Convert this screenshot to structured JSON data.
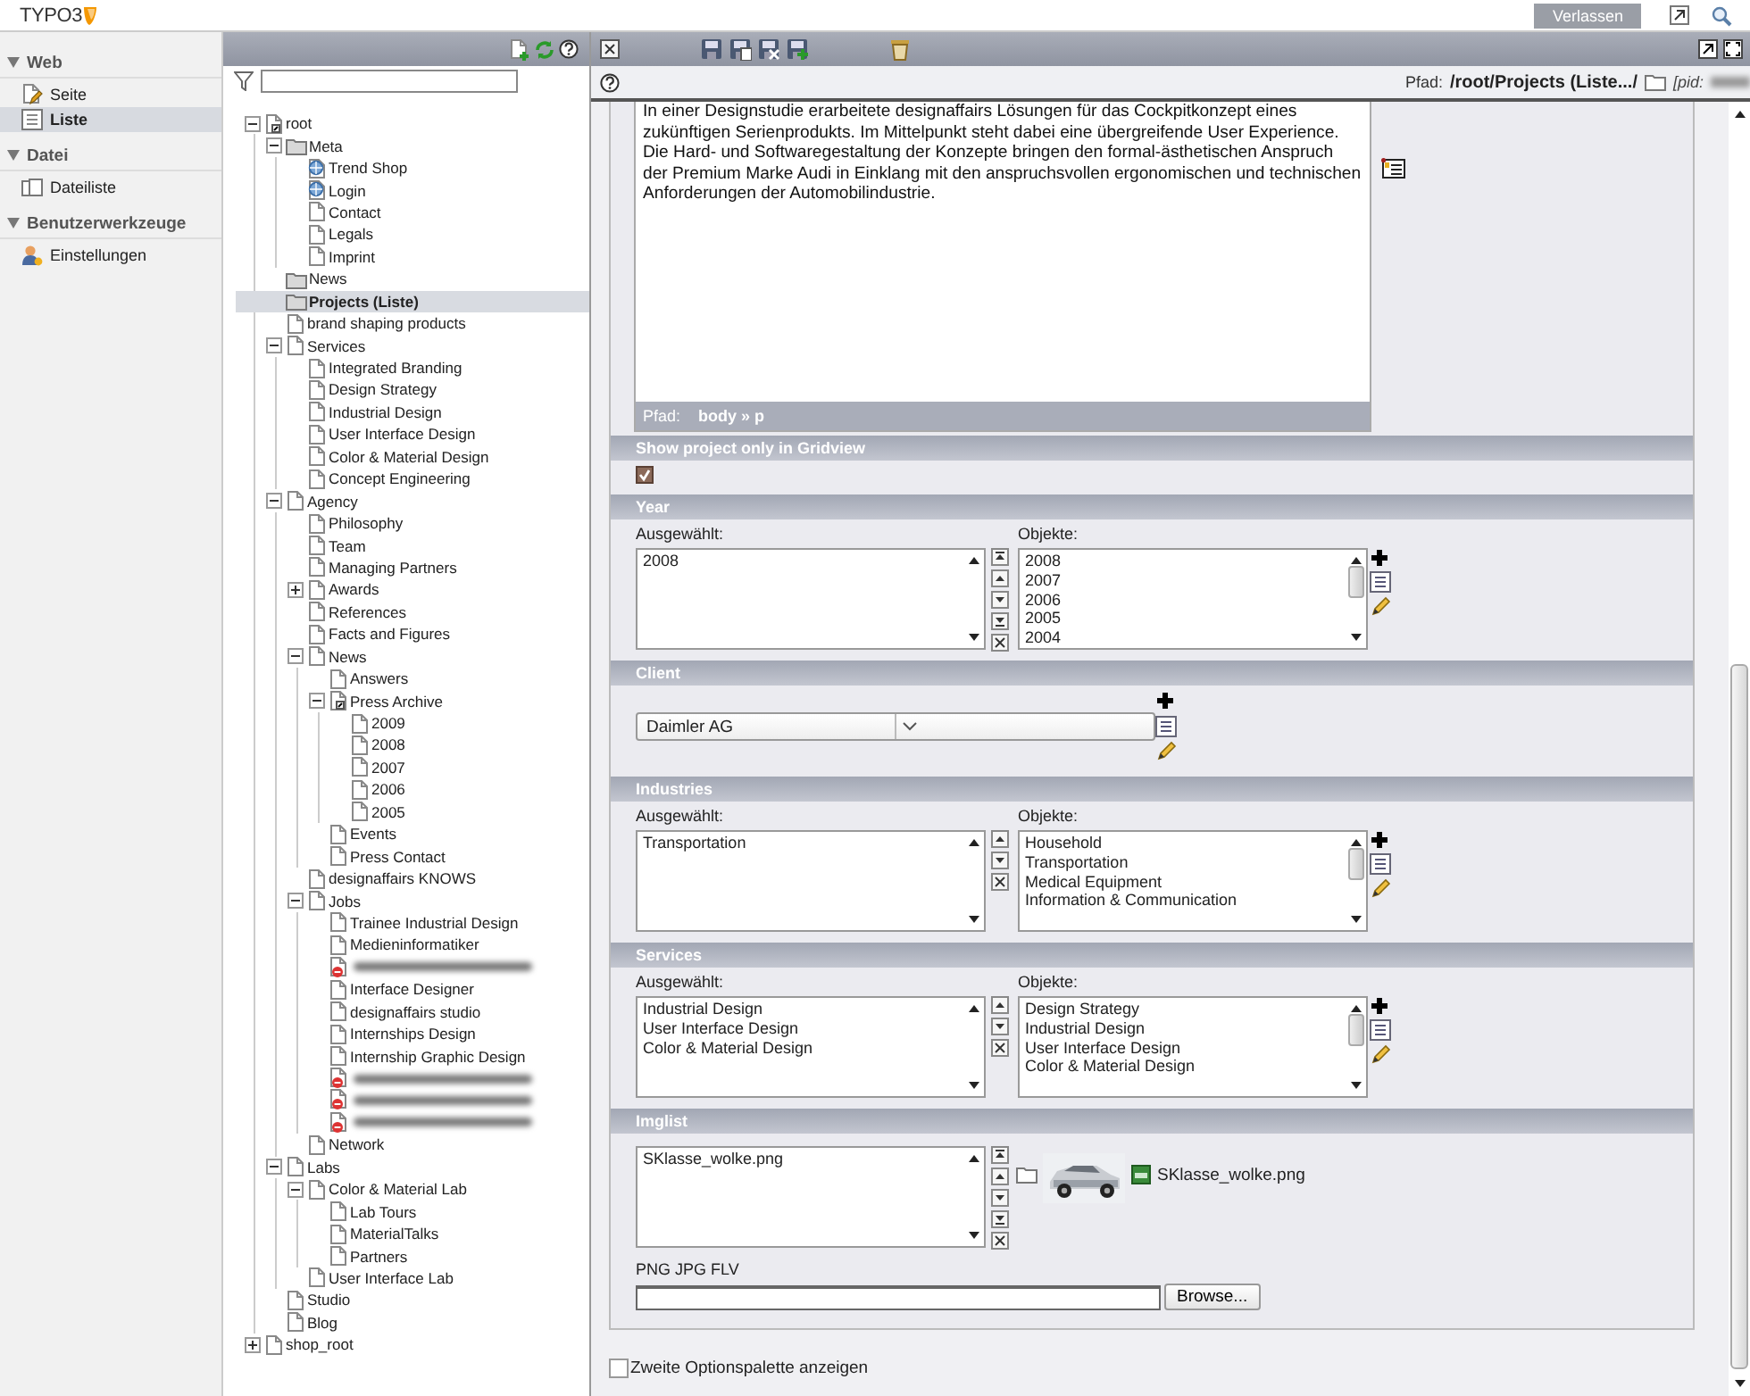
{
  "top_bar": {
    "logo": "TYPO3",
    "logout_button": "Verlassen"
  },
  "modules": [
    {
      "title": "Web",
      "expanded": true,
      "items": [
        {
          "label": "Seite",
          "kind": "page",
          "selected": false
        },
        {
          "label": "Liste",
          "kind": "list",
          "selected": true
        }
      ]
    },
    {
      "title": "Datei",
      "expanded": true,
      "items": [
        {
          "label": "Dateiliste",
          "kind": "files",
          "selected": false
        }
      ]
    },
    {
      "title": "Benutzerwerkzeuge",
      "expanded": true,
      "items": [
        {
          "label": "Einstellungen",
          "kind": "user",
          "selected": false
        }
      ]
    }
  ],
  "page_tree": {
    "nodes": [
      {
        "label": "root",
        "kind": "mount",
        "expanded": true,
        "selected": false,
        "children": [
          {
            "label": "Meta",
            "kind": "folder",
            "expanded": true,
            "selected": false,
            "children": [
              {
                "label": "Trend Shop",
                "kind": "link",
                "selected": false
              },
              {
                "label": "Login",
                "kind": "link",
                "selected": false
              },
              {
                "label": "Contact",
                "kind": "page",
                "selected": false
              },
              {
                "label": "Legals",
                "kind": "page",
                "selected": false
              },
              {
                "label": "Imprint",
                "kind": "page",
                "selected": false
              }
            ]
          },
          {
            "label": "News",
            "kind": "folder",
            "selected": false
          },
          {
            "label": "Projects (Liste)",
            "kind": "folder",
            "selected": true
          },
          {
            "label": "brand shaping products",
            "kind": "page",
            "selected": false
          },
          {
            "label": "Services",
            "kind": "page",
            "expanded": true,
            "selected": false,
            "children": [
              {
                "label": "Integrated Branding",
                "kind": "page",
                "selected": false
              },
              {
                "label": "Design Strategy",
                "kind": "page",
                "selected": false
              },
              {
                "label": "Industrial Design",
                "kind": "page",
                "selected": false
              },
              {
                "label": "User Interface Design",
                "kind": "page",
                "selected": false
              },
              {
                "label": "Color & Material Design",
                "kind": "page",
                "selected": false
              },
              {
                "label": "Concept Engineering",
                "kind": "page",
                "selected": false
              }
            ]
          },
          {
            "label": "Agency",
            "kind": "page",
            "expanded": true,
            "selected": false,
            "children": [
              {
                "label": "Philosophy",
                "kind": "page",
                "selected": false
              },
              {
                "label": "Team",
                "kind": "page",
                "selected": false
              },
              {
                "label": "Managing Partners",
                "kind": "page",
                "selected": false
              },
              {
                "label": "Awards",
                "kind": "page",
                "expanded": false,
                "selected": false
              },
              {
                "label": "References",
                "kind": "page",
                "selected": false
              },
              {
                "label": "Facts and Figures",
                "kind": "page",
                "selected": false
              },
              {
                "label": "News",
                "kind": "page",
                "expanded": true,
                "selected": false,
                "children": [
                  {
                    "label": "Answers",
                    "kind": "page",
                    "selected": false
                  },
                  {
                    "label": "Press Archive",
                    "kind": "shortcut",
                    "expanded": true,
                    "selected": false,
                    "children": [
                      {
                        "label": "2009",
                        "kind": "page",
                        "selected": false
                      },
                      {
                        "label": "2008",
                        "kind": "page",
                        "selected": false
                      },
                      {
                        "label": "2007",
                        "kind": "page",
                        "selected": false
                      },
                      {
                        "label": "2006",
                        "kind": "page",
                        "selected": false
                      },
                      {
                        "label": "2005",
                        "kind": "page",
                        "selected": false
                      }
                    ]
                  },
                  {
                    "label": "Events",
                    "kind": "page",
                    "selected": false
                  },
                  {
                    "label": "Press Contact",
                    "kind": "page",
                    "selected": false
                  }
                ]
              },
              {
                "label": "designaffairs KNOWS",
                "kind": "page",
                "selected": false
              },
              {
                "label": "Jobs",
                "kind": "page",
                "expanded": true,
                "selected": false,
                "children": [
                  {
                    "label": "Trainee Industrial Design",
                    "kind": "page",
                    "selected": false
                  },
                  {
                    "label": "Medieninformatiker",
                    "kind": "page",
                    "selected": false
                  },
                  {
                    "kind": "blurred",
                    "selected": false
                  },
                  {
                    "label": "Interface Designer",
                    "kind": "page",
                    "selected": false
                  },
                  {
                    "label": "designaffairs studio",
                    "kind": "page",
                    "selected": false
                  },
                  {
                    "label": "Internships Design",
                    "kind": "page",
                    "selected": false
                  },
                  {
                    "label": "Internship Graphic Design",
                    "kind": "page",
                    "selected": false
                  },
                  {
                    "kind": "blurred",
                    "selected": false
                  },
                  {
                    "kind": "blurred",
                    "selected": false
                  },
                  {
                    "kind": "blurred",
                    "selected": false
                  }
                ]
              },
              {
                "label": "Network",
                "kind": "page",
                "selected": false
              }
            ]
          },
          {
            "label": "Labs",
            "kind": "page",
            "expanded": true,
            "selected": false,
            "children": [
              {
                "label": "Color & Material Lab",
                "kind": "page",
                "expanded": true,
                "selected": false,
                "children": [
                  {
                    "label": "Lab Tours",
                    "kind": "page",
                    "selected": false
                  },
                  {
                    "label": "MaterialTalks",
                    "kind": "page",
                    "selected": false
                  },
                  {
                    "label": "Partners",
                    "kind": "page",
                    "selected": false
                  }
                ]
              },
              {
                "label": "User Interface Lab",
                "kind": "page",
                "selected": false
              }
            ]
          },
          {
            "label": "Studio",
            "kind": "page",
            "selected": false
          },
          {
            "label": "Blog",
            "kind": "page",
            "selected": false
          }
        ]
      },
      {
        "label": "shop_root",
        "kind": "page",
        "expanded": false,
        "selected": false
      }
    ]
  },
  "editor": {
    "path_label": "Pfad:",
    "path": "/root/Projects (Liste.../",
    "pid_label": "[pid:",
    "rte": {
      "text": "In einer Designstudie erarbeitete designaffairs Lösungen für das Cockpitkonzept eines zukünftigen Serienprodukts. Im Mittelpunkt steht dabei eine übergreifende User Experience. Die Hard- und Softwaregestaltung der Konzepte bringen den formal-ästhetischen Anspruch der Premium Marke Audi in Einklang mit den anspruchsvollen ergonomischen und technischen Anforderungen der Automobilindustrie.",
      "path_label": "Pfad:",
      "path": "body » p"
    },
    "sections": [
      {
        "kind": "checkbox",
        "title": "Show project only in Gridview",
        "checked": true
      },
      {
        "kind": "multiselect",
        "title": "Year",
        "selected_label": "Ausgewählt:",
        "available_label": "Objekte:",
        "selected": [
          "2008"
        ],
        "available": [
          "2008",
          "2007",
          "2006",
          "2005",
          "2004"
        ],
        "full_order": true
      },
      {
        "kind": "dropdown",
        "title": "Client",
        "value": "Daimler AG"
      },
      {
        "kind": "multiselect",
        "title": "Industries",
        "selected_label": "Ausgewählt:",
        "available_label": "Objekte:",
        "selected": [
          "Transportation"
        ],
        "available": [
          "Household",
          "Transportation",
          "Medical Equipment",
          "Information & Communication"
        ],
        "full_order": false
      },
      {
        "kind": "multiselect",
        "title": "Services",
        "selected_label": "Ausgewählt:",
        "available_label": "Objekte:",
        "selected": [
          "Industrial Design",
          "User Interface Design",
          "Color & Material Design"
        ],
        "available": [
          "Design Strategy",
          "Industrial Design",
          "User Interface Design",
          "Color & Material Design"
        ],
        "full_order": false
      },
      {
        "kind": "files",
        "title": "Imglist",
        "selected": [
          "SKlasse_wolke.png"
        ],
        "full_order": true,
        "preview_file": "SKlasse_wolke.png",
        "allowed_types": "PNG JPG FLV",
        "browse_button": "Browse..."
      }
    ],
    "second_options": {
      "label": "Zweite Optionspalette anzeigen",
      "checked": false
    }
  }
}
